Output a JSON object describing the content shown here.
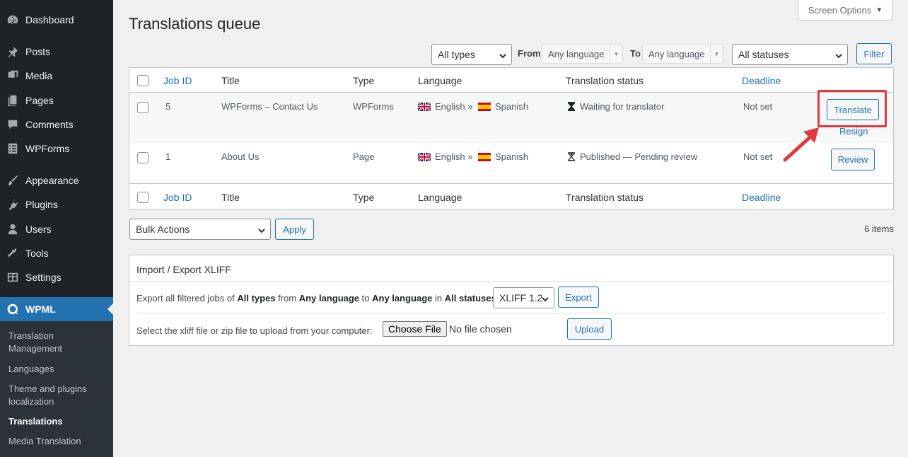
{
  "sidebar": {
    "items": [
      {
        "label": "Dashboard",
        "icon": "dashboard-icon"
      },
      {
        "label": "Posts",
        "icon": "pin-icon"
      },
      {
        "label": "Media",
        "icon": "media-icon"
      },
      {
        "label": "Pages",
        "icon": "pages-icon"
      },
      {
        "label": "Comments",
        "icon": "comment-icon"
      },
      {
        "label": "WPForms",
        "icon": "form-icon"
      },
      {
        "label": "Appearance",
        "icon": "brush-icon"
      },
      {
        "label": "Plugins",
        "icon": "plugin-icon"
      },
      {
        "label": "Users",
        "icon": "user-icon"
      },
      {
        "label": "Tools",
        "icon": "wrench-icon"
      },
      {
        "label": "Settings",
        "icon": "settings-icon"
      },
      {
        "label": "WPML",
        "icon": "wpml-icon"
      }
    ],
    "submenu": [
      "Translation Management",
      "Languages",
      "Theme and plugins localization",
      "Translations",
      "Media Translation"
    ],
    "active_submenu": "Translations"
  },
  "header": {
    "screen_options": "Screen Options",
    "title": "Translations queue"
  },
  "filters": {
    "type": "All types",
    "from_label": "From",
    "from_value": "Any language",
    "to_label": "To",
    "to_value": "Any language",
    "status": "All statuses",
    "filter_button": "Filter"
  },
  "table": {
    "columns": [
      "Job ID",
      "Title",
      "Type",
      "Language",
      "Translation status",
      "Deadline"
    ],
    "rows": [
      {
        "job_id": "5",
        "title": "WPForms – Contact Us",
        "type": "WPForms",
        "lang_from": "English",
        "sep": "»",
        "lang_to": "Spanish",
        "status": "Waiting for translator",
        "deadline": "Not set",
        "action": "Translate",
        "secondary_action": "Resign"
      },
      {
        "job_id": "1",
        "title": "About Us",
        "type": "Page",
        "lang_from": "English",
        "sep": "»",
        "lang_to": "Spanish",
        "status": "Published — Pending review",
        "deadline": "Not set",
        "action": "Review"
      }
    ]
  },
  "bulk": {
    "select": "Bulk Actions",
    "apply": "Apply",
    "items_count": "6 items"
  },
  "xliff": {
    "title": "Import / Export XLIFF",
    "export_prefix": "Export all filtered jobs of",
    "types": "All types",
    "from_word": "from",
    "from_lang": "Any language",
    "to_word": "to",
    "to_lang": "Any language",
    "in_word": "in",
    "statuses": "All statuses:",
    "version": "XLIFF 1.2",
    "export_button": "Export",
    "upload_text": "Select the xliff file or zip file to upload from your computer:",
    "choose_file": "Choose File",
    "no_file": "No file chosen",
    "upload_button": "Upload"
  },
  "colors": {
    "accent": "#2271b1",
    "sidebar_bg": "#1d2327",
    "highlight": "#e0383f"
  }
}
